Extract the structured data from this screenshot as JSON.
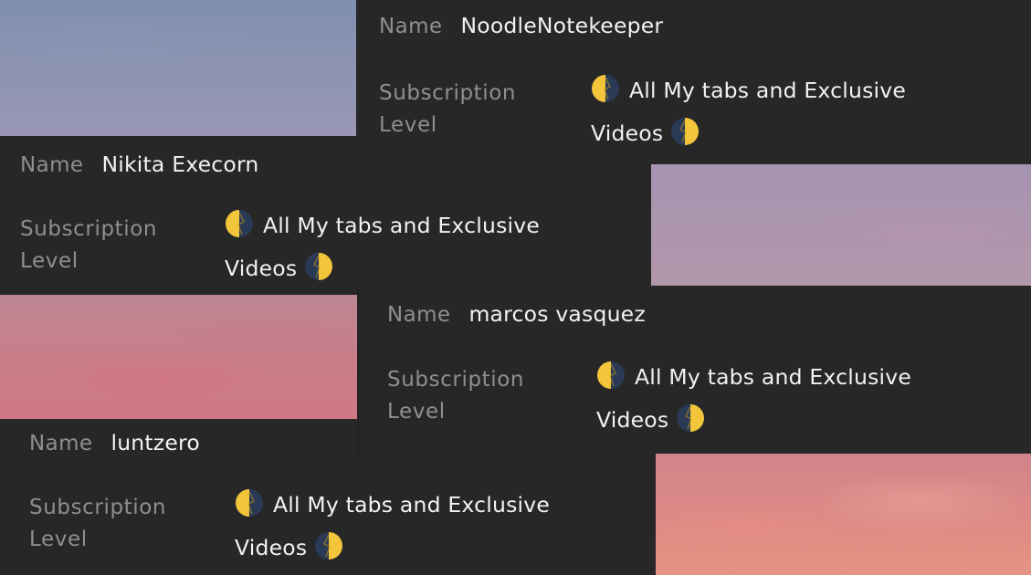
{
  "icons": {
    "leading": "last-quarter-moon-icon",
    "trailing": "first-quarter-moon-icon"
  },
  "colors": {
    "background": "#272727",
    "label": "#8f8f8f",
    "value": "#f2f2f2",
    "moon_yellow": "#f3c53a",
    "moon_dark": "#2a3a56"
  },
  "members": [
    {
      "name_label": "Name",
      "name": "NoodleNotekeeper",
      "sub_label_1": "Subscription",
      "sub_label_2": "Level",
      "tier_line_1": "All My tabs and Exclusive",
      "tier_line_2": "Videos"
    },
    {
      "name_label": "Name",
      "name": "Nikita Execorn",
      "sub_label_1": "Subscription",
      "sub_label_2": "Level",
      "tier_line_1": "All My tabs and Exclusive",
      "tier_line_2": "Videos"
    },
    {
      "name_label": "Name",
      "name": "marcos vasquez",
      "sub_label_1": "Subscription",
      "sub_label_2": "Level",
      "tier_line_1": "All My tabs and Exclusive",
      "tier_line_2": "Videos"
    },
    {
      "name_label": "Name",
      "name": "luntzero",
      "sub_label_1": "Subscription",
      "sub_label_2": "Level",
      "tier_line_1": "All My tabs and Exclusive",
      "tier_line_2": "Videos"
    }
  ]
}
